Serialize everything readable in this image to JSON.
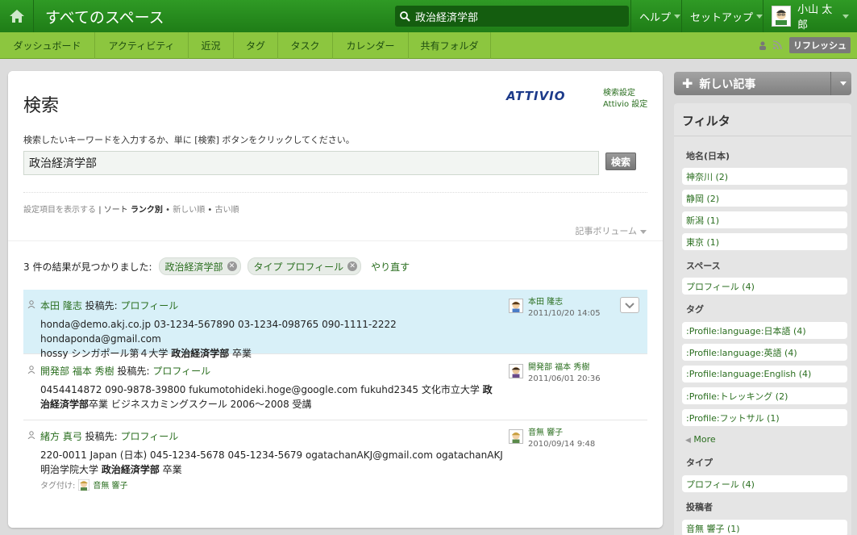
{
  "header": {
    "app_title": "すべてのスペース",
    "search_value": "政治経済学部",
    "help": "ヘルプ",
    "setup": "セットアップ",
    "user_name": "小山 太郎"
  },
  "nav": {
    "tabs": [
      "ダッシュボード",
      "アクティビティ",
      "近況",
      "タグ",
      "タスク",
      "カレンダー",
      "共有フォルダ"
    ],
    "refresh": "リフレッシュ"
  },
  "search": {
    "title": "検索",
    "logo": "ATTIVIO",
    "link1": "検索設定",
    "link2": "Attivio 設定",
    "instructions": "検索したいキーワードを入力するか、単に [検索] ボタンをクリックしてください。",
    "query": "政治経済学部",
    "button": "検索",
    "show_settings": "設定項目を表示する",
    "sort_label": "ソート",
    "sort_rank": "ランク別",
    "sort_new": "新しい順",
    "sort_old": "古い順",
    "volume": "記事ボリューム"
  },
  "results": {
    "summary": "3 件の結果が見つかりました:",
    "chip1": "政治経済学部",
    "chip2": "タイプ プロフィール",
    "retry": "やり直す",
    "posted_to": "投稿先:",
    "items": [
      {
        "name": "本田 隆志",
        "target": "プロフィール",
        "line1": "honda@demo.akj.co.jp 03-1234-567890 03-1234-098765 090-1111-2222 hondaponda@gmail.com",
        "line2_pre": "hossy シンガポール第４大学 ",
        "line2_bold": "政治経済学部",
        "line2_post": " 卒業",
        "author": "本田 隆志",
        "date": "2011/10/20 14:05"
      },
      {
        "name": "開発部 福本 秀樹",
        "target": "プロフィール",
        "line1_pre": "0454414872 090-9878-39800 fukumotohideki.hoge@google.com fukuhd2345 文化市立大学 ",
        "line1_bold": "政治経済学部",
        "line1_post": "卒業 ビジネスカミングスクール 2006～2008 受講",
        "author": "開発部 福本 秀樹",
        "date": "2011/06/01 20:36"
      },
      {
        "name": "緒方 真弓",
        "target": "プロフィール",
        "line1_pre": "220-0011 Japan (日本) 045-1234-5678 045-1234-5679 ogatachanAKJ@gmail.com ogatachanAKJ 明治学院大学 ",
        "line1_bold": "政治経済学部",
        "line1_post": " 卒業",
        "tagged_label": "タグ付け:",
        "tagged_by": "音無 響子",
        "author": "音無 響子",
        "date": "2010/09/14 9:48"
      }
    ]
  },
  "sidebar": {
    "new_post": "新しい記事",
    "filter_title": "フィルタ",
    "place_head": "地名(日本)",
    "places": [
      "神奈川 (2)",
      "静岡 (2)",
      "新潟 (1)",
      "東京 (1)"
    ],
    "space_head": "スペース",
    "spaces": [
      "プロフィール (4)"
    ],
    "tag_head": "タグ",
    "tags": [
      ":Profile:language:日本語 (4)",
      ":Profile:language:英語 (4)",
      ":Profile:language:English (4)",
      ":Profile:トレッキング (2)",
      ":Profile:フットサル (1)"
    ],
    "more": "More",
    "type_head": "タイプ",
    "types": [
      "プロフィール (4)"
    ],
    "poster_head": "投稿者",
    "posters": [
      "音無 響子 (1)"
    ]
  },
  "colors": {
    "header_green": "#2f9a25",
    "nav_green": "#8cc63f",
    "link_green": "#2a6e1f",
    "selected_row": "#d8f0f8"
  }
}
